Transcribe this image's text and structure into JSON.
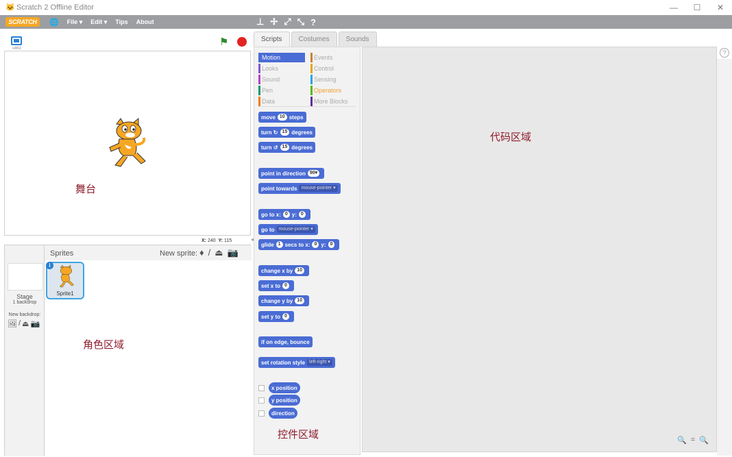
{
  "window": {
    "title": "Scratch 2 Offline Editor",
    "controls": [
      "—",
      "☐",
      "✕"
    ]
  },
  "menu": {
    "logo": "SCRATCH",
    "items": [
      "File ▾",
      "Edit ▾",
      "Tips",
      "About"
    ]
  },
  "stage": {
    "label": "舞台",
    "version": "v461",
    "coords": {
      "x_label": "X:",
      "x": "240",
      "y_label": "Y:",
      "y": "115"
    }
  },
  "sprites": {
    "title": "Sprites",
    "new_sprite": "New sprite:",
    "label": "角色区域",
    "stage_name": "Stage",
    "backdrops": "1 backdrop",
    "new_backdrop": "New backdrop:",
    "items": [
      {
        "name": "Sprite1"
      }
    ]
  },
  "tabs": [
    "Scripts",
    "Costumes",
    "Sounds"
  ],
  "categories": [
    {
      "name": "Motion",
      "color": "#4a6cd4"
    },
    {
      "name": "Looks",
      "color": "#8a55d7"
    },
    {
      "name": "Sound",
      "color": "#bb42c3"
    },
    {
      "name": "Pen",
      "color": "#0e9a6c"
    },
    {
      "name": "Data",
      "color": "#ee7d16"
    },
    {
      "name": "Events",
      "color": "#c88330"
    },
    {
      "name": "Control",
      "color": "#e1a91a"
    },
    {
      "name": "Sensing",
      "color": "#2ca5e2"
    },
    {
      "name": "Operators",
      "color": "#5cb712"
    },
    {
      "name": "More Blocks",
      "color": "#632d99"
    }
  ],
  "palette_label": "控件区域",
  "script_label": "代码区域",
  "blocks": {
    "move": [
      "move",
      "10",
      "steps"
    ],
    "turn_right": [
      "turn",
      "↻",
      "15",
      "degrees"
    ],
    "turn_left": [
      "turn",
      "↺",
      "15",
      "degrees"
    ],
    "point_dir": [
      "point in direction",
      "90▾"
    ],
    "point_towards": [
      "point towards",
      "mouse-pointer ▾"
    ],
    "goto_xy": [
      "go to x:",
      "0",
      "y:",
      "0"
    ],
    "goto": [
      "go to",
      "mouse-pointer ▾"
    ],
    "glide": [
      "glide",
      "1",
      "secs to x:",
      "0",
      "y:",
      "0"
    ],
    "change_x": [
      "change x by",
      "10"
    ],
    "set_x": [
      "set x to",
      "0"
    ],
    "change_y": [
      "change y by",
      "10"
    ],
    "set_y": [
      "set y to",
      "0"
    ],
    "bounce": [
      "if on edge, bounce"
    ],
    "rotation": [
      "set rotation style",
      "left-right ▾"
    ],
    "x_pos": "x position",
    "y_pos": "y position",
    "direction": "direction"
  },
  "zoom": [
    "🔍",
    "=",
    "🔍"
  ]
}
